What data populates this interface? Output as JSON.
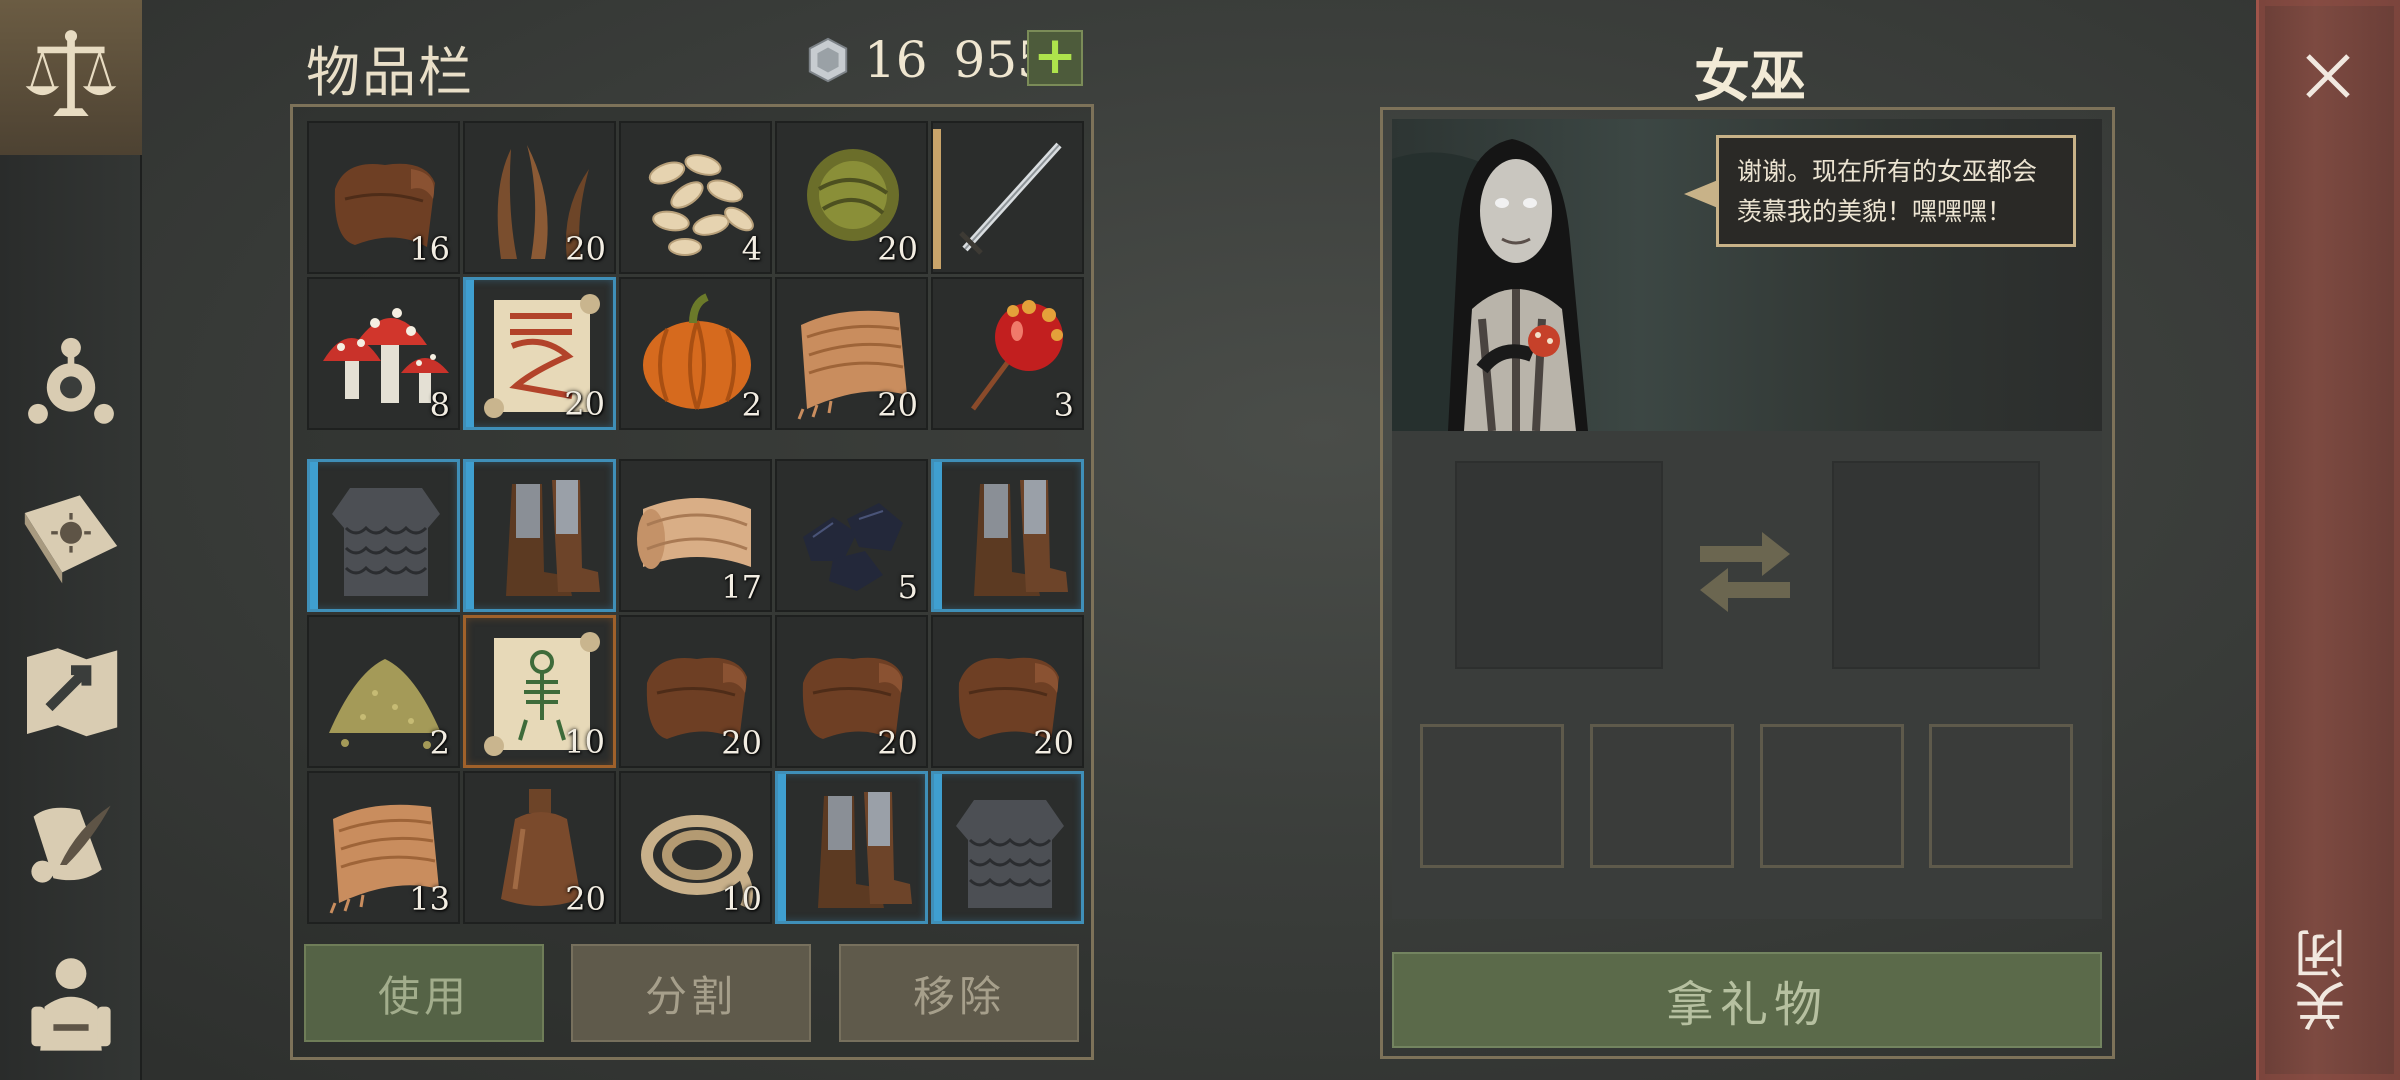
{
  "inventory": {
    "title": "物品栏",
    "currency": {
      "value": "16 955",
      "icon": "silver-coin-icon",
      "add_label": "+"
    },
    "top_grid": [
      {
        "item": "leather-icon",
        "count": "16"
      },
      {
        "item": "plant-fiber-icon",
        "count": "20"
      },
      {
        "item": "seeds-icon",
        "count": "4"
      },
      {
        "item": "grass-bundle-icon",
        "count": "20"
      },
      {
        "item": "sword-icon",
        "count": "",
        "equipped": true
      },
      {
        "item": "fly-agaric-mushroom-icon",
        "count": "8"
      },
      {
        "item": "recipe-scroll-red-icon",
        "count": "20",
        "rarity": "rare"
      },
      {
        "item": "pumpkin-icon",
        "count": "2"
      },
      {
        "item": "cloth-icon",
        "count": "20"
      },
      {
        "item": "candied-apple-icon",
        "count": "3"
      }
    ],
    "bottom_grid": [
      {
        "item": "scale-armor-icon",
        "count": "",
        "rarity": "rare"
      },
      {
        "item": "boots-icon",
        "count": "",
        "rarity": "rare"
      },
      {
        "item": "fabric-roll-icon",
        "count": "17"
      },
      {
        "item": "coal-icon",
        "count": "5"
      },
      {
        "item": "boots-icon",
        "count": "",
        "rarity": "rare"
      },
      {
        "item": "powder-pile-icon",
        "count": "2"
      },
      {
        "item": "skeleton-scroll-icon",
        "count": "10",
        "rarity": "epic"
      },
      {
        "item": "leather-icon",
        "count": "20"
      },
      {
        "item": "leather-icon",
        "count": "20"
      },
      {
        "item": "leather-icon",
        "count": "20"
      },
      {
        "item": "cloth-icon",
        "count": "13"
      },
      {
        "item": "bottle-icon",
        "count": "20"
      },
      {
        "item": "rope-icon",
        "count": "10"
      },
      {
        "item": "boots-icon",
        "count": "",
        "rarity": "rare"
      },
      {
        "item": "scale-armor-icon",
        "count": "",
        "rarity": "rare"
      }
    ],
    "actions": {
      "use": "使用",
      "split": "分割",
      "remove": "移除"
    }
  },
  "npc": {
    "title": "女巫",
    "speech_line1": "谢谢。现在所有的女巫都会",
    "speech_line2": "羡慕我的美貌！嘿嘿嘿！",
    "gift_button": "拿礼物"
  },
  "nav": {
    "items": [
      "scales-icon",
      "compass-icon",
      "sun-book-icon",
      "map-icon",
      "quill-scroll-icon",
      "character-icon"
    ],
    "active": "scales-icon"
  },
  "close": {
    "label": "关闭",
    "icon": "close-icon"
  },
  "colors": {
    "rare_border": "#3f8fb8",
    "epic_border": "#a0612a",
    "confirm_button": "#556346",
    "close_bar": "#7d4a41",
    "accent_plus": "#aee34c"
  }
}
